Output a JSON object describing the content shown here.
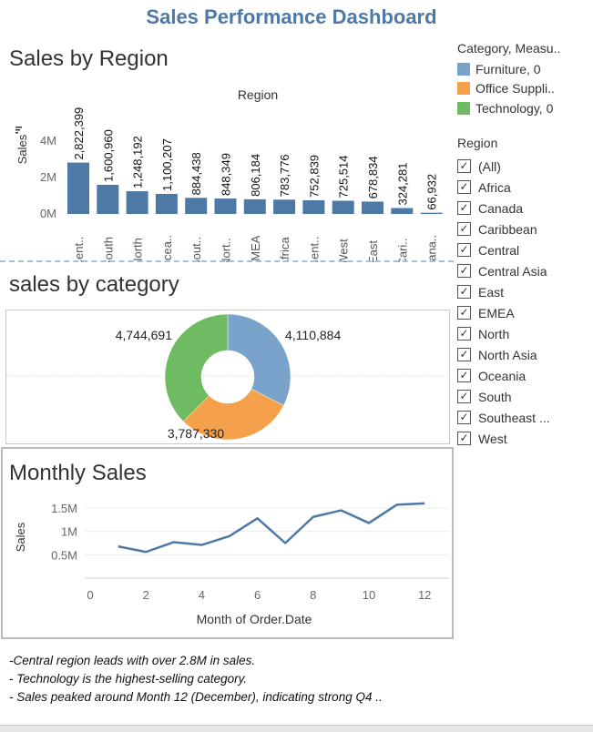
{
  "dashboard": {
    "title": "Sales Performance Dashboard"
  },
  "region_sheet": {
    "title": "Sales by Region",
    "header": "Region",
    "ylabel": "Sales",
    "ticks": [
      "4M",
      "2M",
      "0M"
    ],
    "bar_color": "#4e79a7"
  },
  "category_sheet": {
    "title": "sales by category"
  },
  "monthly_sheet": {
    "title": "Monthly Sales",
    "ylabel": "Sales",
    "xlabel": "Month of Order.Date",
    "yticks": [
      "1.5M",
      "1M",
      "0.5M"
    ],
    "xticks": [
      "0",
      "2",
      "4",
      "6",
      "8",
      "10",
      "12"
    ],
    "line_color": "#4e79a7"
  },
  "legend": {
    "title": "Category, Measu..",
    "items": [
      {
        "label": "Furniture, 0",
        "color": "#7aa3cc"
      },
      {
        "label": "Office Suppli..",
        "color": "#f5a04a"
      },
      {
        "label": "Technology, 0",
        "color": "#6fbb62"
      }
    ]
  },
  "filter": {
    "title": "Region",
    "items": [
      "(All)",
      "Africa",
      "Canada",
      "Caribbean",
      "Central",
      "Central Asia",
      "East",
      "EMEA",
      "North",
      "North Asia",
      "Oceania",
      "South",
      "Southeast ...",
      "West"
    ],
    "check": "✓"
  },
  "notes": [
    "-Central region leads with over 2.8M in sales.",
    "- Technology is the highest-selling category.",
    "- Sales peaked around Month 12 (December), indicating strong Q4 .."
  ],
  "chart_data": [
    {
      "type": "bar",
      "title": "Sales by Region",
      "xlabel": "Region",
      "ylabel": "Sales",
      "categories": [
        "Cent..",
        "South",
        "North",
        "Ocea..",
        "Sout..",
        "Nort..",
        "EMEA",
        "Africa",
        "Cent..",
        "West",
        "East",
        "Cari..",
        "Cana.."
      ],
      "values": [
        2822399,
        1600960,
        1248192,
        1100207,
        884438,
        848349,
        806184,
        783776,
        752839,
        725514,
        678834,
        324281,
        66932
      ],
      "value_labels": [
        "2,822,399",
        "1,600,960",
        "1,248,192",
        "1,100,207",
        "884,438",
        "848,349",
        "806,184",
        "783,776",
        "752,839",
        "725,514",
        "678,834",
        "324,281",
        "66,932"
      ],
      "ylim": [
        0,
        5000000
      ]
    },
    {
      "type": "pie",
      "title": "sales by category",
      "categories": [
        "Furniture",
        "Office Supplies",
        "Technology"
      ],
      "values": [
        4110884,
        3787330,
        4744691
      ],
      "value_labels": [
        "4,110,884",
        "3,787,330",
        "4,744,691"
      ],
      "colors": [
        "#7aa3cc",
        "#f5a04a",
        "#6fbb62"
      ],
      "donut": true
    },
    {
      "type": "line",
      "title": "Monthly Sales",
      "xlabel": "Month of Order.Date",
      "ylabel": "Sales",
      "x": [
        1,
        2,
        3,
        4,
        5,
        6,
        7,
        8,
        9,
        10,
        11,
        12
      ],
      "y": [
        680000,
        560000,
        770000,
        710000,
        900000,
        1280000,
        750000,
        1310000,
        1450000,
        1180000,
        1570000,
        1600000
      ],
      "xlim": [
        -0.5,
        13
      ],
      "ylim": [
        0,
        1800000
      ],
      "grid": true
    }
  ]
}
